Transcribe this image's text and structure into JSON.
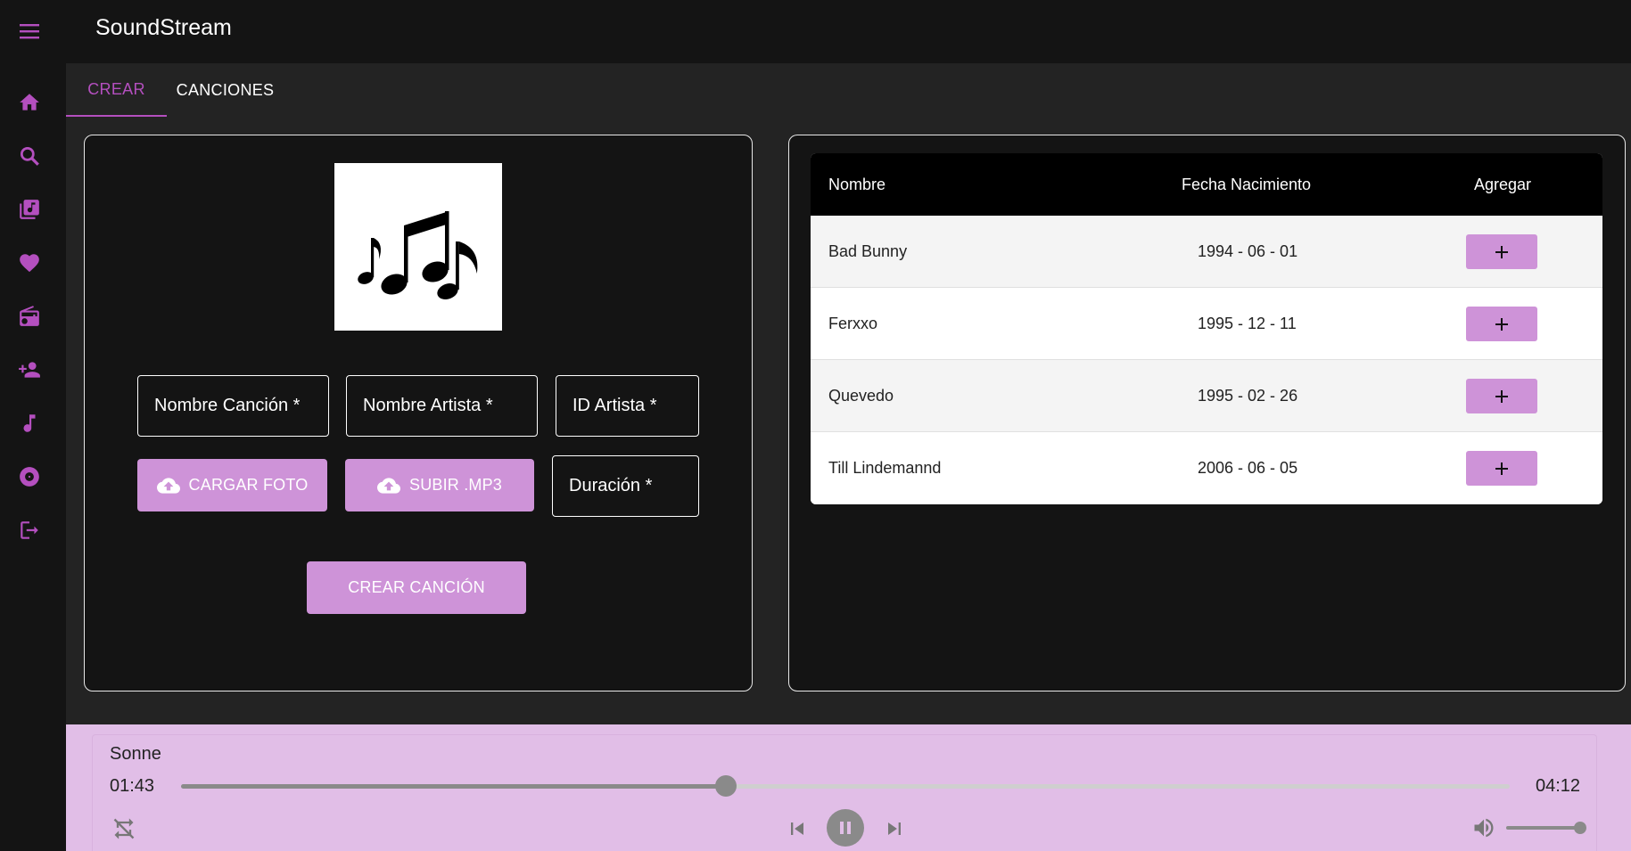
{
  "appbar": {
    "title": "SoundStream",
    "menu_icon": "menu-icon"
  },
  "sidebar": {
    "accent": "#b44fbf",
    "items": [
      {
        "name": "home",
        "icon": "home-icon"
      },
      {
        "name": "search",
        "icon": "search-icon"
      },
      {
        "name": "library",
        "icon": "library-music-icon"
      },
      {
        "name": "favorites",
        "icon": "heart-icon"
      },
      {
        "name": "radio",
        "icon": "radio-icon"
      },
      {
        "name": "add-user",
        "icon": "person-add-icon"
      },
      {
        "name": "music",
        "icon": "music-note-icon"
      },
      {
        "name": "album",
        "icon": "album-icon"
      },
      {
        "name": "logout",
        "icon": "logout-icon"
      }
    ]
  },
  "tabs": [
    {
      "label": "CREAR",
      "active": true
    },
    {
      "label": "CANCIONES",
      "active": false
    }
  ],
  "form": {
    "song_name_label": "Nombre Canción *",
    "artist_name_label": "Nombre Artista *",
    "artist_id_label": "ID Artista *",
    "duration_label": "Duración *",
    "upload_photo_label": "CARGAR FOTO",
    "upload_mp3_label": "SUBIR .MP3",
    "create_label": "CREAR CANCIÓN"
  },
  "artists_table": {
    "headers": [
      "Nombre",
      "Fecha Nacimiento",
      "Agregar"
    ],
    "rows": [
      {
        "name": "Bad Bunny",
        "birth": "1994 - 06 - 01",
        "add": "+"
      },
      {
        "name": "Ferxxo",
        "birth": "1995 - 12 - 11",
        "add": "+"
      },
      {
        "name": "Quevedo",
        "birth": "1995 - 02 - 26",
        "add": "+"
      },
      {
        "name": "Till Lindemannd",
        "birth": "2006 - 06 - 05",
        "add": "+"
      }
    ]
  },
  "player": {
    "song": "Sonne",
    "current_time": "01:43",
    "total_time": "04:12",
    "progress": 0.41,
    "volume": 1.0,
    "background": "#e1bee7"
  },
  "colors": {
    "accent": "#b44fbf",
    "button": "#ce93d8",
    "panel": "#141414",
    "background": "#232323"
  }
}
